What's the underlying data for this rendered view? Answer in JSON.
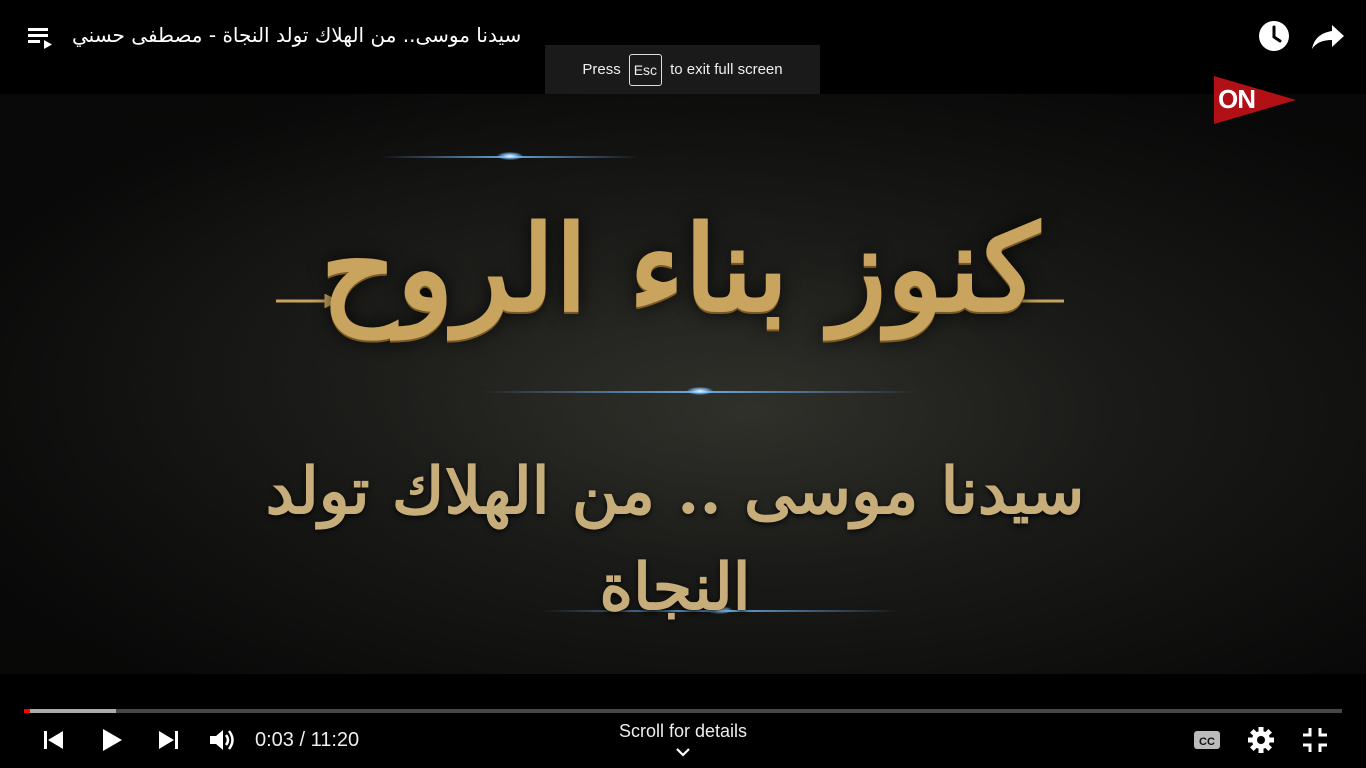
{
  "header": {
    "video_title": "سيدنا موسى.. من الهلاك تولد النجاة - مصطفى حسني",
    "icons": {
      "playlist": "playlist-icon",
      "watch_later": "clock-icon",
      "share": "share-arrow-icon"
    }
  },
  "fullscreen_toast": {
    "prefix": "Press",
    "key": "Esc",
    "suffix": "to exit full screen"
  },
  "video_frame": {
    "channel_logo": "ON",
    "title_text": "كنوز بناء الروح",
    "subtitle_text": "سيدنا موسى .. من الهلاك تولد النجاة"
  },
  "controls": {
    "progress_played_fraction": 0.0044,
    "progress_buffered_fraction": 0.07,
    "current_time": "0:03",
    "separator": "/",
    "duration": "11:20",
    "time_text": "0:03 / 11:20",
    "scroll_hint": "Scroll for details",
    "icons": {
      "previous": "previous-icon",
      "play": "play-icon",
      "next": "next-icon",
      "volume": "volume-icon",
      "captions": "captions-icon",
      "settings": "gear-icon",
      "exit_fullscreen": "exit-fullscreen-icon",
      "scroll": "chevron-down-icon"
    }
  },
  "colors": {
    "progress_played": "#ff0000",
    "title_gold": "#c8a45e",
    "logo_red": "#c4121a"
  }
}
